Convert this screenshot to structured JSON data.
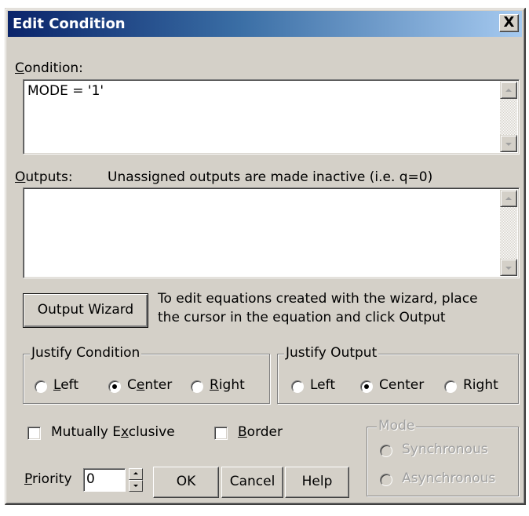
{
  "window": {
    "title": "Edit Condition",
    "close_glyph": "X"
  },
  "condition": {
    "label_first": "C",
    "label_rest": "ondition:",
    "value": "MODE = '1'"
  },
  "outputs": {
    "label_first": "O",
    "label_rest": "utputs:",
    "note": "Unassigned outputs are made inactive (i.e. q=0)",
    "value": ""
  },
  "wizard": {
    "button_label": "Output Wizard",
    "hint_line1": "To edit equations created with the wizard, place",
    "hint_line2": "the cursor in the equation and click Output"
  },
  "justify_condition": {
    "title": "Justify Condition",
    "left": {
      "pre": "",
      "acc": "L",
      "post": "eft"
    },
    "center": {
      "pre": "C",
      "acc": "e",
      "post": "nter"
    },
    "right": {
      "pre": "",
      "acc": "R",
      "post": "ight"
    },
    "selected": "Center"
  },
  "justify_output": {
    "title": "Justify Output",
    "left": "Left",
    "center": "Center",
    "right": "Right",
    "selected": "Center"
  },
  "options": {
    "mutex": {
      "pre": "Mutually E",
      "acc": "x",
      "post": "clusive",
      "checked": false
    },
    "border": {
      "pre": "",
      "acc": "B",
      "post": "order",
      "checked": false
    }
  },
  "mode": {
    "title": "Mode",
    "synchronous": "Synchronous",
    "asynchronous": "Asynchronous",
    "enabled": false
  },
  "priority": {
    "acc": "P",
    "post": "riority",
    "value": "0"
  },
  "buttons": {
    "ok": "OK",
    "cancel": "Cancel",
    "help": "Help"
  }
}
